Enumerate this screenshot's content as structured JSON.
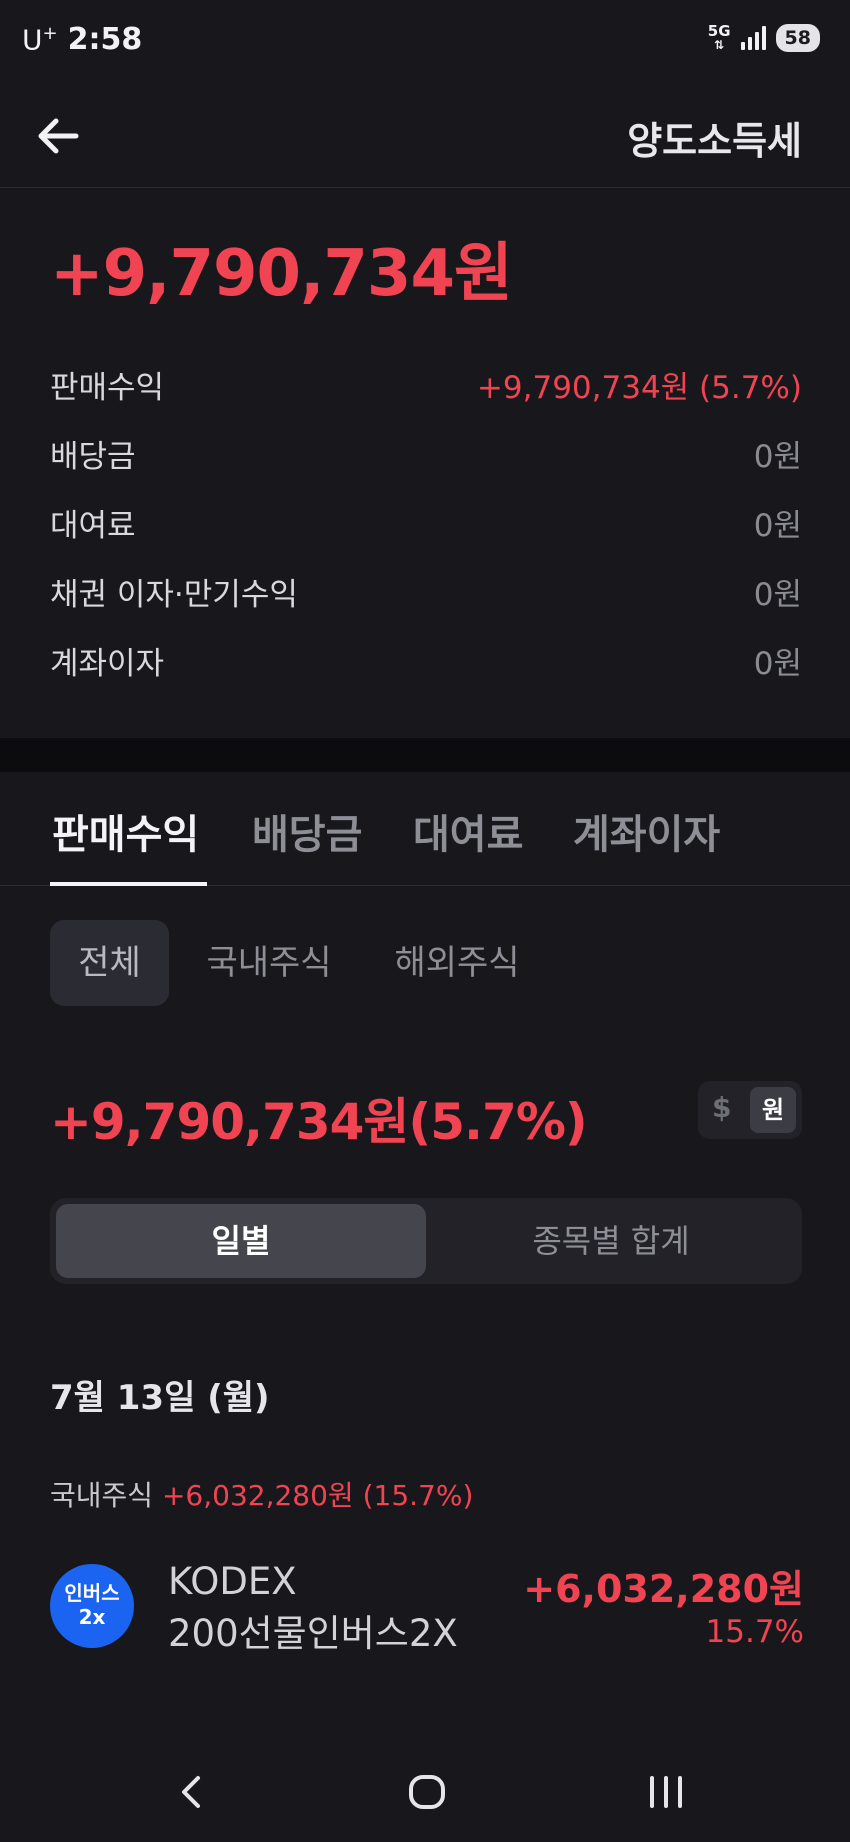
{
  "status": {
    "carrier": "U",
    "carrier_sup": "+",
    "time": "2:58",
    "network": "5G",
    "battery": "58"
  },
  "header": {
    "title": "양도소득세"
  },
  "summary": {
    "total": "+9,790,734원",
    "rows": [
      {
        "label": "판매수익",
        "value": "+9,790,734원 (5.7%)"
      },
      {
        "label": "배당금",
        "value": "0원"
      },
      {
        "label": "대여료",
        "value": "0원"
      },
      {
        "label": "채권 이자·만기수익",
        "value": "0원"
      },
      {
        "label": "계좌이자",
        "value": "0원"
      }
    ]
  },
  "tabs": [
    "판매수익",
    "배당금",
    "대여료",
    "계좌이자"
  ],
  "filters": [
    "전체",
    "국내주식",
    "해외주식"
  ],
  "sub_total": "+9,790,734원(5.7%)",
  "currency": {
    "usd": "$",
    "krw": "원"
  },
  "view_toggle": {
    "daily": "일별",
    "by_stock": "종목별 합계"
  },
  "date": "7월 13일 (월)",
  "group": {
    "label": "국내주식",
    "value": "+6,032,280원 (15.7%)"
  },
  "item": {
    "logo_line1": "인버스",
    "logo_line2": "2x",
    "name_line1": "KODEX",
    "name_line2": "200선물인버스2X",
    "amount": "+6,032,280원",
    "percent": "15.7%"
  },
  "colors": {
    "red": "#f04452",
    "background": "#17171c",
    "logo_blue": "#1b64f2"
  }
}
